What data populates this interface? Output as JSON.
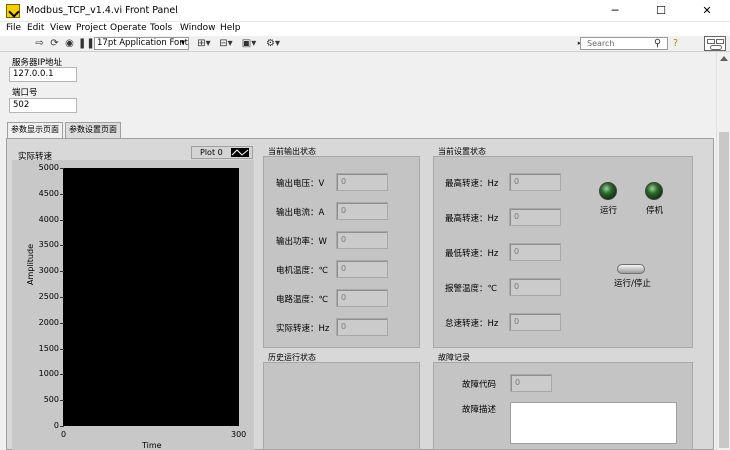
{
  "window": {
    "title": "Modbus_TCP_v1.4.vi Front Panel",
    "minimize": "─",
    "maximize": "☐",
    "close": "✕"
  },
  "menu": [
    "File",
    "Edit",
    "View",
    "Project",
    "Operate",
    "Tools",
    "Window",
    "Help"
  ],
  "toolbar": {
    "font": "17pt Application Font",
    "search_placeholder": "Search"
  },
  "connection": {
    "ip_label": "服务器IP地址",
    "ip_value": "127.0.0.1",
    "port_label": "端口号",
    "port_value": "502"
  },
  "tabs": [
    {
      "label": "参数显示页面",
      "active": true
    },
    {
      "label": "参数设置页面",
      "active": false
    }
  ],
  "chart": {
    "title": "实际转速",
    "plot_legend": "Plot 0",
    "ylabel": "Amplitude",
    "xlabel": "Time",
    "y_ticks": [
      "5000",
      "4500",
      "4000",
      "3500",
      "3000",
      "2500",
      "2000",
      "1500",
      "1000",
      "500",
      "0"
    ],
    "x_ticks": [
      "0",
      "300"
    ]
  },
  "chart_data": {
    "type": "line",
    "title": "",
    "xlabel": "Time",
    "ylabel": "Amplitude",
    "xlim": [
      0,
      300
    ],
    "ylim": [
      0,
      5000
    ],
    "series": [
      {
        "name": "Plot 0",
        "values": []
      }
    ]
  },
  "output_status": {
    "title": "当前输出状态",
    "rows": [
      {
        "label": "输出电压：V",
        "value": "0"
      },
      {
        "label": "输出电流：A",
        "value": "0"
      },
      {
        "label": "输出功率：W",
        "value": "0"
      },
      {
        "label": "电机温度：℃",
        "value": "0"
      },
      {
        "label": "电路温度：℃",
        "value": "0"
      },
      {
        "label": "实际转速：Hz",
        "value": "0"
      }
    ]
  },
  "setting_status": {
    "title": "当前设置状态",
    "rows": [
      {
        "label": "最高转速：Hz",
        "value": "0"
      },
      {
        "label": "最高转速：Hz",
        "value": "0"
      },
      {
        "label": "最低转速：Hz",
        "value": "0"
      },
      {
        "label": "报警温度：℃",
        "value": "0"
      },
      {
        "label": "怠速转速：Hz",
        "value": "0"
      }
    ],
    "led_run": "运行",
    "led_stop": "停机",
    "switch_label": "运行/停止"
  },
  "history": {
    "title": "历史运行状态"
  },
  "fault": {
    "title": "故障记录",
    "code_label": "故障代码",
    "code_value": "0",
    "desc_label": "故障描述",
    "desc_value": ""
  },
  "colors": {
    "plot_bg": "#000000",
    "led_green": "#2d6a2d",
    "panel_bg": "#c4c4c4"
  }
}
